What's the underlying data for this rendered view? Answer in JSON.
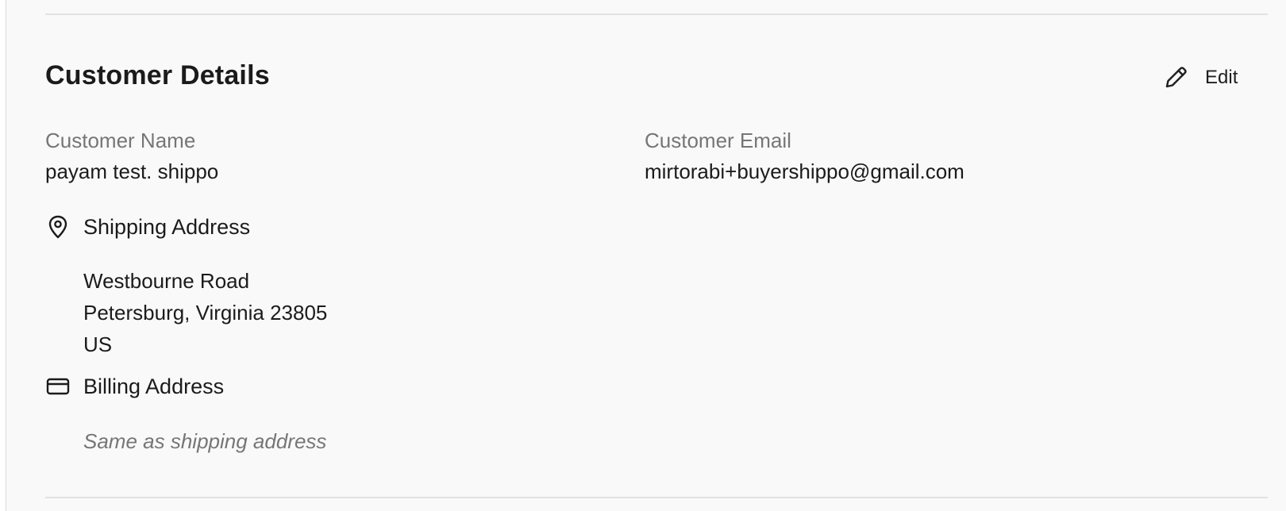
{
  "section": {
    "title": "Customer Details",
    "edit_label": "Edit"
  },
  "customer": {
    "name_label": "Customer Name",
    "name_value": "payam test. shippo",
    "email_label": "Customer Email",
    "email_value": "mirtorabi+buyershippo@gmail.com"
  },
  "shipping": {
    "title": "Shipping Address",
    "icon": "map-pin-icon",
    "lines": [
      "Westbourne Road",
      "Petersburg, Virginia 23805",
      "US"
    ]
  },
  "billing": {
    "title": "Billing Address",
    "icon": "credit-card-icon",
    "note": "Same as shipping address"
  }
}
